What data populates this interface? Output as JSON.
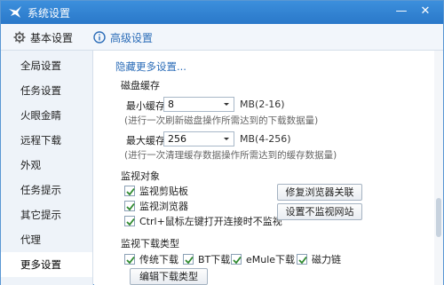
{
  "window": {
    "title": "系统设置",
    "minimize_glyph": "—",
    "close_glyph": "✕"
  },
  "tabs": {
    "basic": "基本设置",
    "advanced": "高级设置"
  },
  "sidebar": {
    "items": [
      {
        "label": "全局设置"
      },
      {
        "label": "任务设置"
      },
      {
        "label": "火眼金睛"
      },
      {
        "label": "远程下载"
      },
      {
        "label": "外观"
      },
      {
        "label": "任务提示"
      },
      {
        "label": "其它提示"
      },
      {
        "label": "代理"
      },
      {
        "label": "更多设置"
      }
    ],
    "active_index": 8
  },
  "main": {
    "hide_link": "隐藏更多设置...",
    "disk_cache": {
      "title": "磁盘缓存",
      "min": {
        "label": "最小缓存",
        "value": "8",
        "unit": "MB(2-16)",
        "hint": "(进行一次刷新磁盘操作所需达到的下载数据量)"
      },
      "max": {
        "label": "最大缓存",
        "value": "256",
        "unit": "MB(4-256)",
        "hint": "(进行一次清理缓存数据操作所需达到的缓存数据量)"
      }
    },
    "monitor": {
      "title": "监视对象",
      "clipboard": "监视剪贴板",
      "browser": "监视浏览器",
      "ctrl_click": "Ctrl+鼠标左键打开连接时不监视",
      "repair_button": "修复浏览器关联",
      "set_sites_button": "设置不监视网站"
    },
    "download_types": {
      "title": "监视下载类型",
      "traditional": "传统下载",
      "bt": "BT下载",
      "emule": "eMule下载",
      "magnet": "磁力链",
      "edit_button": "编辑下载类型"
    }
  },
  "colors": {
    "titlebar": "#2a78c9",
    "link": "#2c6db8",
    "sidebar_bg": "#eef3f9"
  }
}
